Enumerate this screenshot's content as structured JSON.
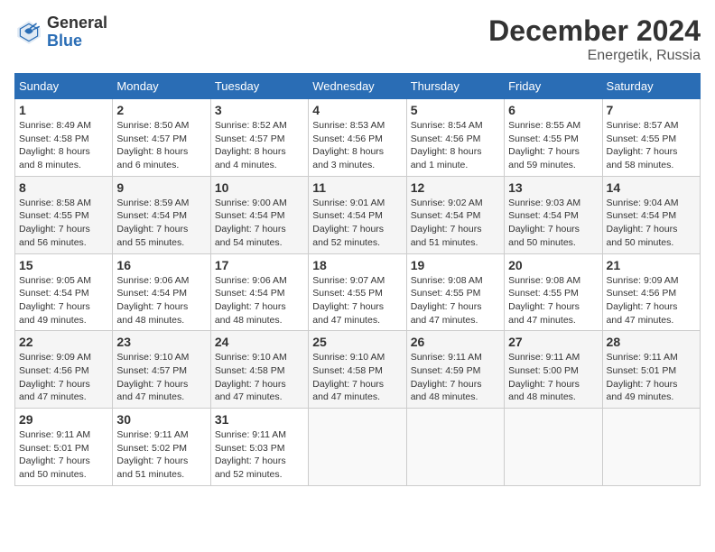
{
  "header": {
    "logo_general": "General",
    "logo_blue": "Blue",
    "title": "December 2024",
    "subtitle": "Energetik, Russia"
  },
  "days_of_week": [
    "Sunday",
    "Monday",
    "Tuesday",
    "Wednesday",
    "Thursday",
    "Friday",
    "Saturday"
  ],
  "weeks": [
    [
      {
        "day": "1",
        "info": "Sunrise: 8:49 AM\nSunset: 4:58 PM\nDaylight: 8 hours\nand 8 minutes."
      },
      {
        "day": "2",
        "info": "Sunrise: 8:50 AM\nSunset: 4:57 PM\nDaylight: 8 hours\nand 6 minutes."
      },
      {
        "day": "3",
        "info": "Sunrise: 8:52 AM\nSunset: 4:57 PM\nDaylight: 8 hours\nand 4 minutes."
      },
      {
        "day": "4",
        "info": "Sunrise: 8:53 AM\nSunset: 4:56 PM\nDaylight: 8 hours\nand 3 minutes."
      },
      {
        "day": "5",
        "info": "Sunrise: 8:54 AM\nSunset: 4:56 PM\nDaylight: 8 hours\nand 1 minute."
      },
      {
        "day": "6",
        "info": "Sunrise: 8:55 AM\nSunset: 4:55 PM\nDaylight: 7 hours\nand 59 minutes."
      },
      {
        "day": "7",
        "info": "Sunrise: 8:57 AM\nSunset: 4:55 PM\nDaylight: 7 hours\nand 58 minutes."
      }
    ],
    [
      {
        "day": "8",
        "info": "Sunrise: 8:58 AM\nSunset: 4:55 PM\nDaylight: 7 hours\nand 56 minutes."
      },
      {
        "day": "9",
        "info": "Sunrise: 8:59 AM\nSunset: 4:54 PM\nDaylight: 7 hours\nand 55 minutes."
      },
      {
        "day": "10",
        "info": "Sunrise: 9:00 AM\nSunset: 4:54 PM\nDaylight: 7 hours\nand 54 minutes."
      },
      {
        "day": "11",
        "info": "Sunrise: 9:01 AM\nSunset: 4:54 PM\nDaylight: 7 hours\nand 52 minutes."
      },
      {
        "day": "12",
        "info": "Sunrise: 9:02 AM\nSunset: 4:54 PM\nDaylight: 7 hours\nand 51 minutes."
      },
      {
        "day": "13",
        "info": "Sunrise: 9:03 AM\nSunset: 4:54 PM\nDaylight: 7 hours\nand 50 minutes."
      },
      {
        "day": "14",
        "info": "Sunrise: 9:04 AM\nSunset: 4:54 PM\nDaylight: 7 hours\nand 50 minutes."
      }
    ],
    [
      {
        "day": "15",
        "info": "Sunrise: 9:05 AM\nSunset: 4:54 PM\nDaylight: 7 hours\nand 49 minutes."
      },
      {
        "day": "16",
        "info": "Sunrise: 9:06 AM\nSunset: 4:54 PM\nDaylight: 7 hours\nand 48 minutes."
      },
      {
        "day": "17",
        "info": "Sunrise: 9:06 AM\nSunset: 4:54 PM\nDaylight: 7 hours\nand 48 minutes."
      },
      {
        "day": "18",
        "info": "Sunrise: 9:07 AM\nSunset: 4:55 PM\nDaylight: 7 hours\nand 47 minutes."
      },
      {
        "day": "19",
        "info": "Sunrise: 9:08 AM\nSunset: 4:55 PM\nDaylight: 7 hours\nand 47 minutes."
      },
      {
        "day": "20",
        "info": "Sunrise: 9:08 AM\nSunset: 4:55 PM\nDaylight: 7 hours\nand 47 minutes."
      },
      {
        "day": "21",
        "info": "Sunrise: 9:09 AM\nSunset: 4:56 PM\nDaylight: 7 hours\nand 47 minutes."
      }
    ],
    [
      {
        "day": "22",
        "info": "Sunrise: 9:09 AM\nSunset: 4:56 PM\nDaylight: 7 hours\nand 47 minutes."
      },
      {
        "day": "23",
        "info": "Sunrise: 9:10 AM\nSunset: 4:57 PM\nDaylight: 7 hours\nand 47 minutes."
      },
      {
        "day": "24",
        "info": "Sunrise: 9:10 AM\nSunset: 4:58 PM\nDaylight: 7 hours\nand 47 minutes."
      },
      {
        "day": "25",
        "info": "Sunrise: 9:10 AM\nSunset: 4:58 PM\nDaylight: 7 hours\nand 47 minutes."
      },
      {
        "day": "26",
        "info": "Sunrise: 9:11 AM\nSunset: 4:59 PM\nDaylight: 7 hours\nand 48 minutes."
      },
      {
        "day": "27",
        "info": "Sunrise: 9:11 AM\nSunset: 5:00 PM\nDaylight: 7 hours\nand 48 minutes."
      },
      {
        "day": "28",
        "info": "Sunrise: 9:11 AM\nSunset: 5:01 PM\nDaylight: 7 hours\nand 49 minutes."
      }
    ],
    [
      {
        "day": "29",
        "info": "Sunrise: 9:11 AM\nSunset: 5:01 PM\nDaylight: 7 hours\nand 50 minutes."
      },
      {
        "day": "30",
        "info": "Sunrise: 9:11 AM\nSunset: 5:02 PM\nDaylight: 7 hours\nand 51 minutes."
      },
      {
        "day": "31",
        "info": "Sunrise: 9:11 AM\nSunset: 5:03 PM\nDaylight: 7 hours\nand 52 minutes."
      },
      {
        "day": "",
        "info": ""
      },
      {
        "day": "",
        "info": ""
      },
      {
        "day": "",
        "info": ""
      },
      {
        "day": "",
        "info": ""
      }
    ]
  ]
}
